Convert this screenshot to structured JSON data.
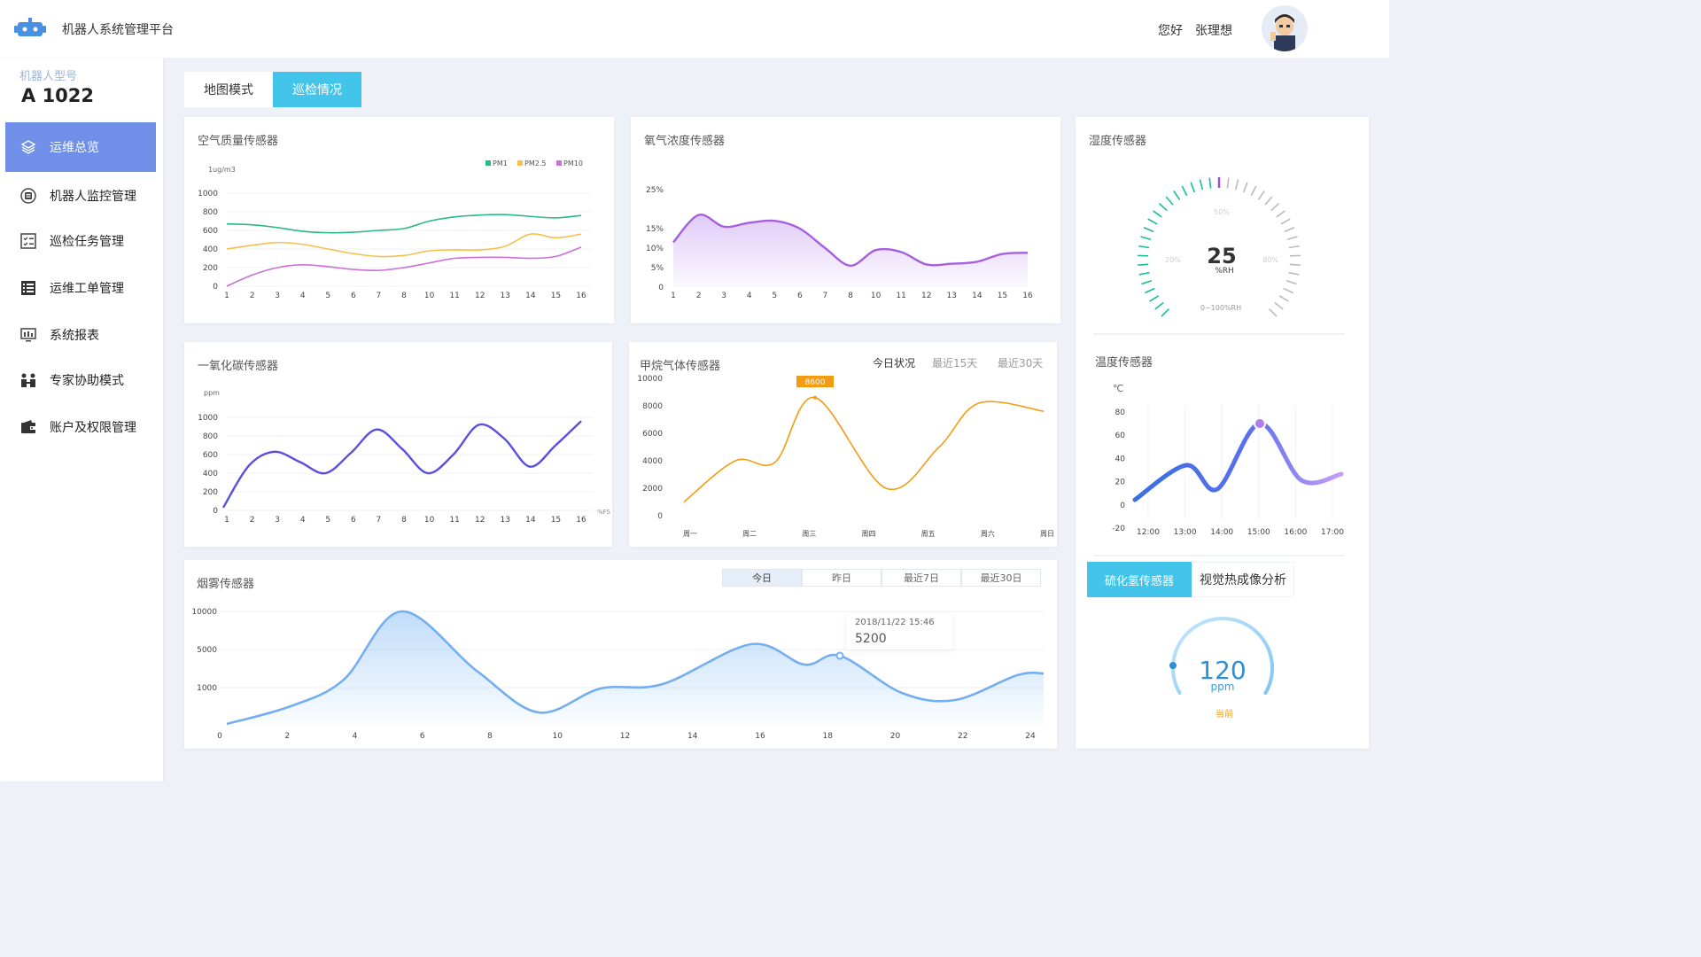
{
  "header": {
    "app_title": "机器人系统管理平台",
    "greeting": "您好",
    "user_name": "张理想"
  },
  "sidebar": {
    "model_label": "机器人型号",
    "model_value": "A 1022",
    "items": [
      {
        "label": "运维总览",
        "icon": "layers-icon",
        "active": true
      },
      {
        "label": "机器人监控管理",
        "icon": "robot-monitor-icon"
      },
      {
        "label": "巡检任务管理",
        "icon": "checklist-icon"
      },
      {
        "label": "运维工单管理",
        "icon": "list-icon"
      },
      {
        "label": "系统报表",
        "icon": "monitor-report-icon"
      },
      {
        "label": "专家协助模式",
        "icon": "experts-icon"
      },
      {
        "label": "账户及权限管理",
        "icon": "wallet-icon"
      }
    ]
  },
  "view_tabs": [
    {
      "label": "地图模式",
      "active": false
    },
    {
      "label": "巡检情况",
      "active": true
    }
  ],
  "colors": {
    "accent": "#43c4ea",
    "nav_active": "#6f8fe8",
    "pm1": "#2bb98a",
    "pm25": "#f4c04e",
    "pm10": "#cc6fd6",
    "oxygen": "#a65fe0",
    "co": "#5a4ee0",
    "methane": "#f39c12",
    "smoke": "#74aef0",
    "humidity_gauge": "#1abc9c"
  },
  "air_quality": {
    "title": "空气质量传感器",
    "unit": "1ug/m3",
    "chart_data": {
      "type": "line",
      "x": [
        1,
        2,
        3,
        4,
        5,
        6,
        7,
        8,
        10,
        11,
        12,
        13,
        14,
        15,
        16
      ],
      "ylim": [
        0,
        1000
      ],
      "yticks": [
        0,
        200,
        400,
        600,
        800,
        1000
      ],
      "series": [
        {
          "name": "PM1",
          "values": [
            670,
            660,
            630,
            590,
            575,
            580,
            600,
            620,
            700,
            745,
            765,
            770,
            750,
            735,
            760
          ]
        },
        {
          "name": "PM2.5",
          "values": [
            400,
            440,
            470,
            450,
            400,
            350,
            320,
            330,
            380,
            390,
            390,
            430,
            560,
            520,
            560
          ]
        },
        {
          "name": "PM10",
          "values": [
            0,
            120,
            200,
            230,
            210,
            180,
            170,
            200,
            250,
            300,
            310,
            310,
            300,
            320,
            420
          ]
        }
      ]
    }
  },
  "oxygen": {
    "title": "氧气浓度传感器",
    "chart_data": {
      "type": "area",
      "x": [
        1,
        2,
        3,
        4,
        5,
        6,
        7,
        8,
        10,
        11,
        12,
        13,
        14,
        15,
        16
      ],
      "yticks": [
        "0",
        "5%",
        "10%",
        "15%",
        "20%",
        "25%"
      ],
      "yticks_shown": [
        "0",
        "5%",
        "10%",
        "15%",
        "25%"
      ],
      "ylim": [
        0,
        25
      ],
      "values": [
        11.5,
        18.5,
        15.5,
        16.5,
        17.0,
        15.0,
        10.0,
        5.5,
        9.5,
        9.0,
        5.8,
        6.0,
        6.5,
        8.5,
        8.8
      ]
    }
  },
  "humidity": {
    "title": "湿度传感器",
    "value": "25",
    "unit": "%RH",
    "range_label": "0~100%RH",
    "tick_labels": [
      "20%",
      "50%",
      "80%"
    ],
    "percent": 25
  },
  "co": {
    "title": "一氧化碳传感器",
    "unit": "ppm",
    "x_unit": "%FS",
    "chart_data": {
      "type": "line",
      "x": [
        1,
        2,
        3,
        4,
        5,
        6,
        7,
        8,
        10,
        11,
        12,
        13,
        14,
        15,
        16
      ],
      "ylim": [
        0,
        1000
      ],
      "yticks": [
        0,
        200,
        400,
        600,
        800,
        1000
      ],
      "values": [
        30,
        480,
        630,
        520,
        400,
        620,
        870,
        660,
        400,
        600,
        920,
        770,
        470,
        700,
        960
      ]
    }
  },
  "methane": {
    "title": "甲烷气体传感器",
    "ranges": [
      {
        "label": "今日状况",
        "active": true
      },
      {
        "label": "最近15天"
      },
      {
        "label": "最近30天"
      }
    ],
    "highlight": "8600",
    "chart_data": {
      "type": "line",
      "categories": [
        "周一",
        "周二",
        "周三",
        "周四",
        "周五",
        "周六",
        "周日"
      ],
      "ylim": [
        0,
        10000
      ],
      "yticks": [
        0,
        2000,
        4000,
        6000,
        8000,
        10000
      ],
      "values": [
        1000,
        4000,
        8600,
        2000,
        5000,
        8200,
        7500
      ]
    }
  },
  "temperature": {
    "title": "温度传感器",
    "unit": "℃",
    "chart_data": {
      "type": "line",
      "categories": [
        "12:00",
        "13:00",
        "14:00",
        "15:00",
        "16:00",
        "17:00"
      ],
      "ylim": [
        -20,
        80
      ],
      "yticks": [
        -20,
        0,
        20,
        40,
        60,
        80
      ],
      "values": [
        5,
        35,
        10,
        70,
        30,
        28
      ]
    }
  },
  "smoke": {
    "title": "烟雾传感器",
    "ranges": [
      {
        "label": "今日",
        "active": true
      },
      {
        "label": "昨日"
      },
      {
        "label": "最近7日"
      },
      {
        "label": "最近30日"
      }
    ],
    "tooltip_time": "2018/11/22 15:46",
    "tooltip_value": "5200",
    "chart_data": {
      "type": "area",
      "xticks": [
        0,
        2,
        4,
        6,
        8,
        10,
        12,
        14,
        16,
        18,
        20,
        22,
        24
      ],
      "yticks_shown": [
        "1000",
        "5000",
        "10000"
      ],
      "values": [
        0,
        1000,
        2500,
        5000,
        10000,
        7000,
        2000,
        2500,
        4000,
        4000,
        7000,
        4500,
        5200,
        3000,
        2000,
        1800,
        3000,
        4000
      ]
    }
  },
  "bottom_right": {
    "tab_h2s": "硫化氢传感器",
    "tab_thermal": "视觉热成像分析",
    "value": "120",
    "unit": "ppm",
    "caption": "当前"
  }
}
